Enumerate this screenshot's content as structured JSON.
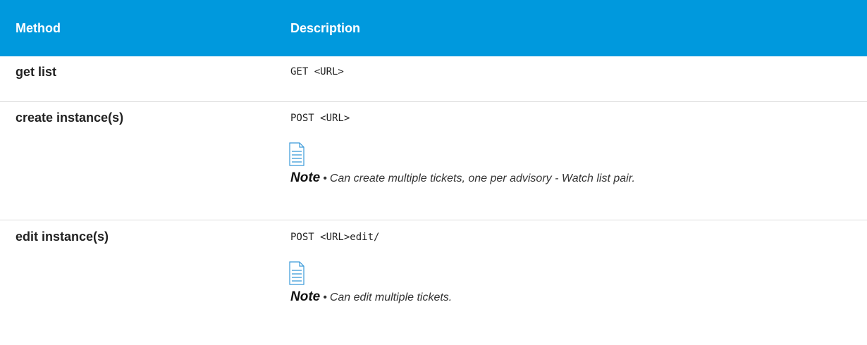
{
  "header": {
    "col_method": "Method",
    "col_description": "Description"
  },
  "rows": [
    {
      "method": "get list",
      "code": "GET <URL>"
    },
    {
      "method": "create instance(s)",
      "code": "POST <URL>",
      "note_label": "Note",
      "note_text": "Can create multiple tickets, one per advisory - Watch list pair."
    },
    {
      "method": "edit instance(s)",
      "code": "POST <URL>edit/",
      "note_label": "Note",
      "note_text": "Can edit multiple tickets."
    }
  ],
  "bullet": "•",
  "icons": {
    "attachment": "document-icon"
  },
  "colors": {
    "header_bg": "#0099dd",
    "header_text": "#ffffff",
    "icon_blue": "#3a9ad9"
  }
}
